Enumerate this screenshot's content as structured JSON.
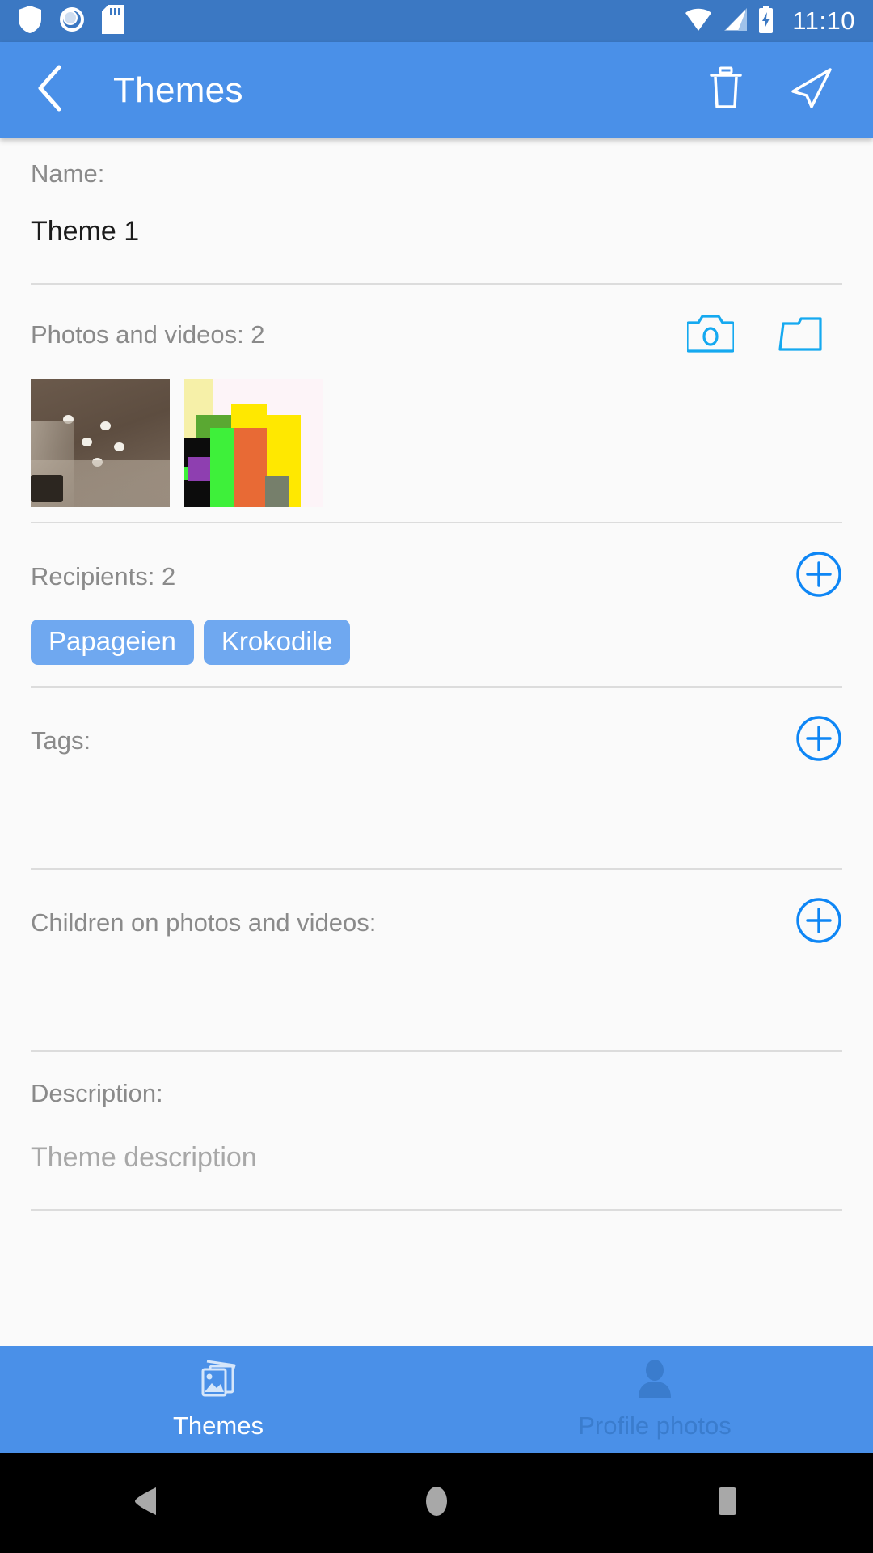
{
  "status_bar": {
    "icons": [
      "shield-icon",
      "sync-icon",
      "sd-card-icon",
      "wifi-icon",
      "cellular-signal-icon",
      "battery-charging-icon"
    ],
    "time": "11:10",
    "background": "#3b78c3"
  },
  "app_bar": {
    "back_icon": "chevron-left-icon",
    "title": "Themes",
    "delete_icon": "trash-icon",
    "send_icon": "send-icon",
    "background": "#4a90e8"
  },
  "form": {
    "name": {
      "label": "Name:",
      "value": "Theme 1"
    },
    "photos": {
      "label": "Photos and videos: 2",
      "count": 2,
      "camera_icon": "camera-icon",
      "folder_icon": "folder-icon",
      "accent": "#15a9f0",
      "thumbnails": [
        {
          "name": "ceiling-photo",
          "alt": "Ceiling with recessed spot lights"
        },
        {
          "name": "color-blocks-photo",
          "alt": "Colorful abstract pixel blocks"
        }
      ]
    },
    "recipients": {
      "label": "Recipients: 2",
      "count": 2,
      "add_icon": "add-circle-icon",
      "chips": [
        "Papageien",
        "Krokodile"
      ],
      "chip_color": "#6fa8f0"
    },
    "tags": {
      "label": "Tags:",
      "add_icon": "add-circle-icon",
      "items": []
    },
    "children": {
      "label": "Children on photos and videos:",
      "add_icon": "add-circle-icon",
      "items": []
    },
    "description": {
      "label": "Description:",
      "placeholder": "Theme description",
      "value": ""
    }
  },
  "tab_bar": {
    "tabs": [
      {
        "label": "Themes",
        "icon": "photo-library-icon",
        "active": true
      },
      {
        "label": "Profile photos",
        "icon": "person-icon",
        "active": false
      }
    ]
  },
  "nav_bar": {
    "back_icon": "nav-back-triangle-icon",
    "home_icon": "nav-home-circle-icon",
    "recents_icon": "nav-recents-square-icon"
  }
}
